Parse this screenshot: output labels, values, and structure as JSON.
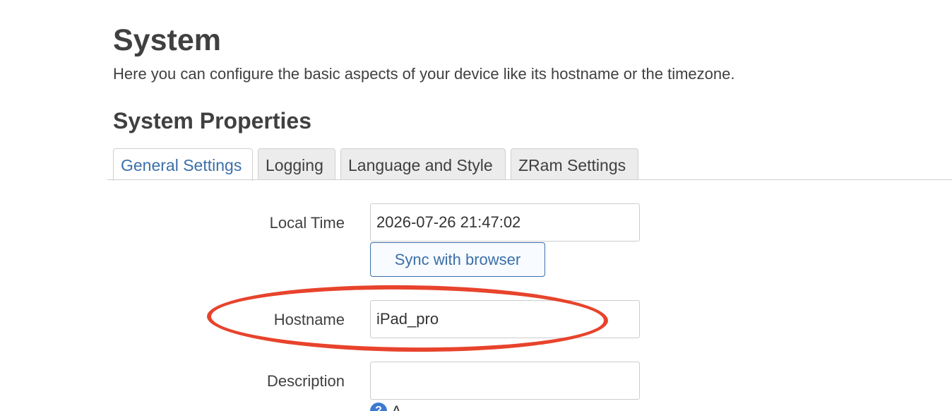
{
  "header": {
    "title": "System",
    "description": "Here you can configure the basic aspects of your device like its hostname or the timezone."
  },
  "section": {
    "title": "System Properties"
  },
  "tabs": [
    {
      "label": "General Settings",
      "active": true
    },
    {
      "label": "Logging",
      "active": false
    },
    {
      "label": "Language and Style",
      "active": false
    },
    {
      "label": "ZRam Settings",
      "active": false
    }
  ],
  "form": {
    "local_time": {
      "label": "Local Time",
      "value": "2026-07-26 21:47:02",
      "sync_button_label": "Sync with browser"
    },
    "hostname": {
      "label": "Hostname",
      "value": "iPad_pro"
    },
    "description": {
      "label": "Description",
      "value": "",
      "hint": "A"
    }
  },
  "annotation": {
    "color": "#e8432c"
  },
  "colors": {
    "accent": "#3b6fa8",
    "text": "#404040"
  },
  "icons": {
    "hint_icon": "help-circle-icon",
    "hint_glyph": "?"
  }
}
